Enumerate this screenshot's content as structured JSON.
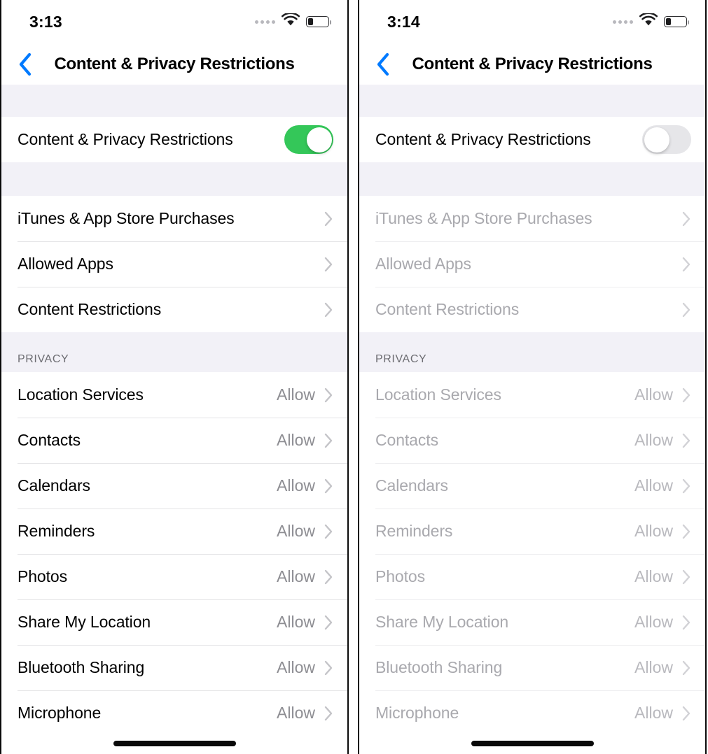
{
  "panels": [
    {
      "id": "restrictions-enabled",
      "status": {
        "time": "3:13",
        "signal_dots": 4,
        "wifi": "wifi-icon",
        "battery": "battery-low-icon"
      },
      "nav": {
        "back": "back-chevron-icon",
        "title": "Content & Privacy Restrictions"
      },
      "master_toggle": {
        "label": "Content & Privacy Restrictions",
        "state": "on"
      },
      "restriction_rows": [
        {
          "label": "iTunes & App Store Purchases"
        },
        {
          "label": "Allowed Apps"
        },
        {
          "label": "Content Restrictions"
        }
      ],
      "privacy_header": "PRIVACY",
      "privacy_rows": [
        {
          "label": "Location Services",
          "value": "Allow"
        },
        {
          "label": "Contacts",
          "value": "Allow"
        },
        {
          "label": "Calendars",
          "value": "Allow"
        },
        {
          "label": "Reminders",
          "value": "Allow"
        },
        {
          "label": "Photos",
          "value": "Allow"
        },
        {
          "label": "Share My Location",
          "value": "Allow"
        },
        {
          "label": "Bluetooth Sharing",
          "value": "Allow"
        },
        {
          "label": "Microphone",
          "value": "Allow"
        }
      ]
    },
    {
      "id": "restrictions-disabled",
      "status": {
        "time": "3:14",
        "signal_dots": 4,
        "wifi": "wifi-icon",
        "battery": "battery-low-icon"
      },
      "nav": {
        "back": "back-chevron-icon",
        "title": "Content & Privacy Restrictions"
      },
      "master_toggle": {
        "label": "Content & Privacy Restrictions",
        "state": "off"
      },
      "restriction_rows": [
        {
          "label": "iTunes & App Store Purchases"
        },
        {
          "label": "Allowed Apps"
        },
        {
          "label": "Content Restrictions"
        }
      ],
      "privacy_header": "PRIVACY",
      "privacy_rows": [
        {
          "label": "Location Services",
          "value": "Allow"
        },
        {
          "label": "Contacts",
          "value": "Allow"
        },
        {
          "label": "Calendars",
          "value": "Allow"
        },
        {
          "label": "Reminders",
          "value": "Allow"
        },
        {
          "label": "Photos",
          "value": "Allow"
        },
        {
          "label": "Share My Location",
          "value": "Allow"
        },
        {
          "label": "Bluetooth Sharing",
          "value": "Allow"
        },
        {
          "label": "Microphone",
          "value": "Allow"
        }
      ]
    }
  ],
  "colors": {
    "accent_blue": "#007aff",
    "toggle_on_green": "#34c759",
    "toggle_off_gray": "#e6e6e9",
    "group_bg": "#f2f1f7",
    "secondary_text": "#8e8e93",
    "disabled_text": "#a9a9ae"
  }
}
